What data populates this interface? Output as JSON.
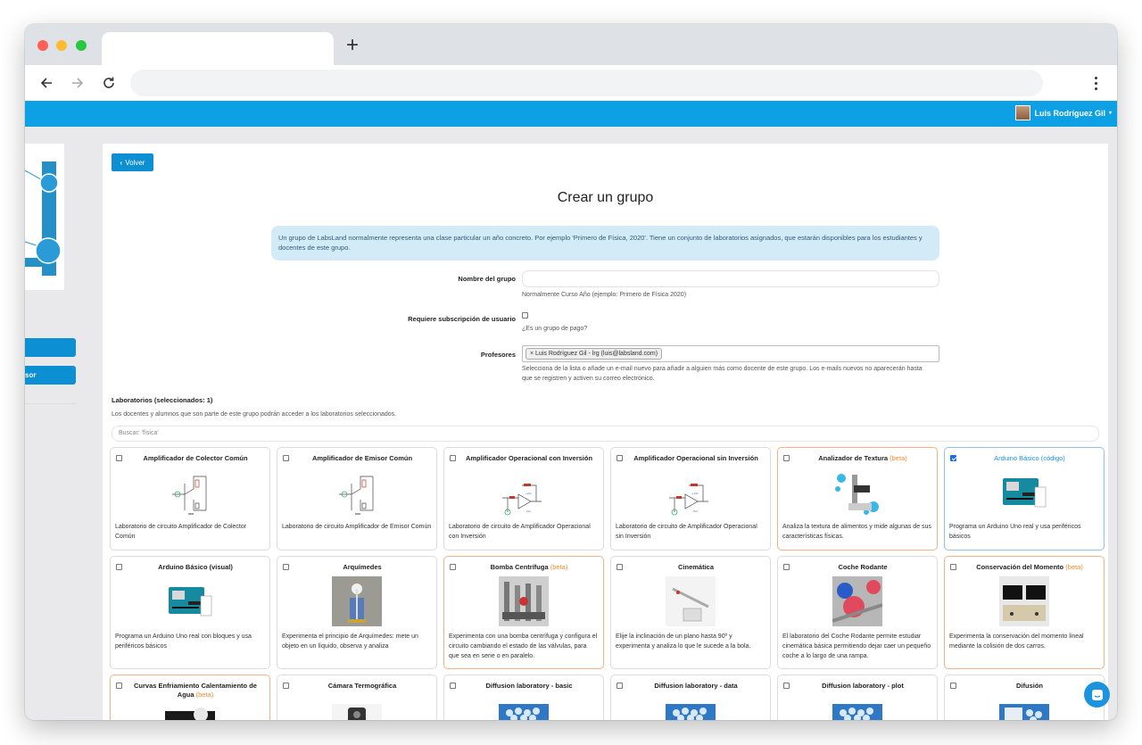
{
  "app": {
    "user_name": "Luis Rodríguez Gil"
  },
  "sidebar": {
    "buttons": [
      "",
      "sor"
    ]
  },
  "page": {
    "back_label": "Volver",
    "title": "Crear un grupo",
    "info": "Un grupo de LabsLand normalmente representa una clase particular un año concreto. Por ejemplo 'Primero de Física, 2020'. Tiene un conjunto de laboratorios asignados, que estarán disponibles para los estudiantes y docentes de este grupo."
  },
  "form": {
    "group_name_label": "Nombre del grupo",
    "group_name_value": "",
    "group_name_help": "Normalmente Curso Año (ejemplo: Primero de Física 2020)",
    "subscription_label": "Requiere subscripción de usuario",
    "subscription_help": "¿Es un grupo de pago?",
    "teachers_label": "Profesores",
    "teacher_tag": "× Luis Rodríguez Gil - lrg (luis@labsland.com)",
    "teachers_help": "Selecciona de la lista o añade un e-mail nuevo para añadir a alguien más como docente de este grupo. Los e-mails nuevos no aparecerán hasta que se registren y activen su correo electrónico."
  },
  "labs": {
    "heading": "Laboratorios (seleccionados: 1)",
    "subtitle": "Los docentes y alumnos que son parte de este grupo podrán acceder a los laboratorios seleccionados.",
    "search_placeholder": "Buscar: 'física'",
    "beta_label": "(beta)",
    "items": [
      {
        "name": "Amplificador de Colector Común",
        "desc": "Laboratorio de circuito Amplificador de Colector Común",
        "beta": false,
        "selected": false,
        "icon": "circuit"
      },
      {
        "name": "Amplificador de Emisor Común",
        "desc": "Laboratorio de circuito Amplificador de Emisor Común",
        "beta": false,
        "selected": false,
        "icon": "circuit"
      },
      {
        "name": "Amplificador Operacional con Inversión",
        "desc": "Laboratorio de circuito de Amplificador Operacional con Inversión",
        "beta": false,
        "selected": false,
        "icon": "opamp"
      },
      {
        "name": "Amplificador Operacional sin Inversión",
        "desc": "Laboratorio de circuito de Amplificador Operacional sin Inversión",
        "beta": false,
        "selected": false,
        "icon": "opamp"
      },
      {
        "name": "Analizador de Textura",
        "desc": "Analiza la textura de alimentos y mide algunas de sus características físicas.",
        "beta": true,
        "selected": false,
        "icon": "texture"
      },
      {
        "name": "Arduino Básico (código)",
        "desc": "Programa un Arduino Uno real y usa periféricos básicos",
        "beta": false,
        "selected": true,
        "icon": "arduino"
      },
      {
        "name": "Arduino Básico (visual)",
        "desc": "Programa un Arduino Uno real con bloques y usa periféricos básicos",
        "beta": false,
        "selected": false,
        "icon": "arduino"
      },
      {
        "name": "Arquímedes",
        "desc": "Experimenta el principio de Arquímedes: mete un objeto en un líquido, observa y analiza",
        "beta": false,
        "selected": false,
        "icon": "archimedes"
      },
      {
        "name": "Bomba Centrífuga",
        "desc": "Experimenta con una bomba centrífuga y configura el circuito cambiando el estado de las válvulas, para que sea en serie o en paralelo.",
        "beta": true,
        "selected": false,
        "icon": "pump"
      },
      {
        "name": "Cinemática",
        "desc": "Elije la inclinación de un plano hasta 90º y experimenta y analiza lo que le sucede a la bola.",
        "beta": false,
        "selected": false,
        "icon": "kinematics"
      },
      {
        "name": "Coche Rodante",
        "desc": "El laboratorio del Coche Rodante permite estudiar cinemática básica permitiendo dejar caer un pequeño coche a lo largo de una rampa.",
        "beta": false,
        "selected": false,
        "icon": "car"
      },
      {
        "name": "Conservación del Momento",
        "desc": "Experimenta la conservación del momento lineal mediante la colisión de dos carros.",
        "beta": true,
        "selected": false,
        "icon": "momentum"
      },
      {
        "name": "Curvas Enfriamiento Calentamiento de Agua",
        "desc": "",
        "beta": true,
        "selected": false,
        "icon": "water"
      },
      {
        "name": "Cámara Termográfica",
        "desc": "",
        "beta": false,
        "selected": false,
        "icon": "camera"
      },
      {
        "name": "Diffusion laboratory - basic",
        "desc": "",
        "beta": false,
        "selected": false,
        "icon": "diffusion"
      },
      {
        "name": "Diffusion laboratory - data",
        "desc": "",
        "beta": false,
        "selected": false,
        "icon": "diffusion"
      },
      {
        "name": "Diffusion laboratory - plot",
        "desc": "",
        "beta": false,
        "selected": false,
        "icon": "diffusion"
      },
      {
        "name": "Difusión",
        "desc": "",
        "beta": false,
        "selected": false,
        "icon": "diffusion2"
      }
    ]
  },
  "colors": {
    "brand": "#0da0e4",
    "button": "#0d8fd3",
    "beta": "#f08a30",
    "selected": "#1a8fd6"
  }
}
